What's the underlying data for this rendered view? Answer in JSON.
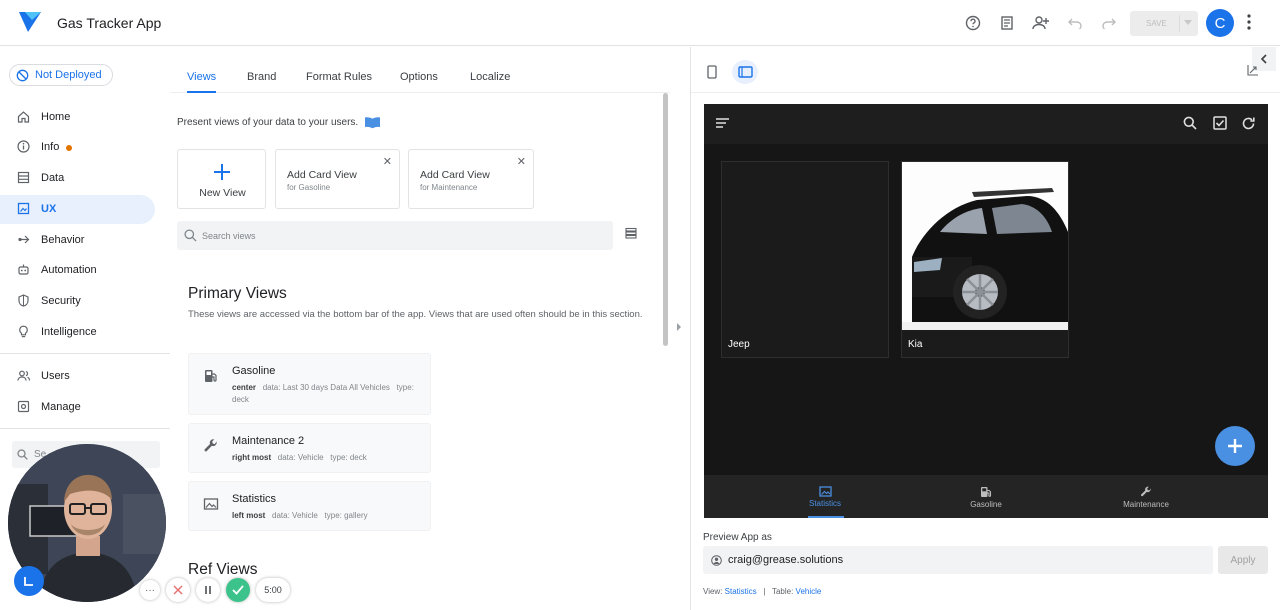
{
  "app": {
    "title": "Gas Tracker App"
  },
  "toolbar": {
    "save_label": "SAVE",
    "avatar_letter": "C"
  },
  "deploy": {
    "label": "Not Deployed"
  },
  "sidebar": {
    "items": [
      {
        "label": "Home"
      },
      {
        "label": "Info"
      },
      {
        "label": "Data"
      },
      {
        "label": "UX"
      },
      {
        "label": "Behavior"
      },
      {
        "label": "Automation"
      },
      {
        "label": "Security"
      },
      {
        "label": "Intelligence"
      },
      {
        "label": "Users"
      },
      {
        "label": "Manage"
      }
    ],
    "search_placeholder": "Se"
  },
  "tabs": [
    {
      "label": "Views"
    },
    {
      "label": "Brand"
    },
    {
      "label": "Format Rules"
    },
    {
      "label": "Options"
    },
    {
      "label": "Localize"
    }
  ],
  "views": {
    "intro": "Present views of your data to your users.",
    "new_view": "New View",
    "suggestions": [
      {
        "title": "Add Card View",
        "subtitle": "for Gasoline"
      },
      {
        "title": "Add Card View",
        "subtitle": "for Maintenance"
      }
    ],
    "search_placeholder": "Search views"
  },
  "primary": {
    "title": "Primary Views",
    "description": "These views are accessed via the bottom bar of the app. Views that are used often should be in this section.",
    "items": [
      {
        "name": "Gasoline",
        "position": "center",
        "data_label": "data:",
        "data": "Last 30 days Data All Vehicles",
        "type_label": "type:",
        "type": "deck"
      },
      {
        "name": "Maintenance 2",
        "position": "right most",
        "data_label": "data:",
        "data": "Vehicle",
        "type_label": "type:",
        "type": "deck"
      },
      {
        "name": "Statistics",
        "position": "left most",
        "data_label": "data:",
        "data": "Vehicle",
        "type_label": "type:",
        "type": "gallery"
      }
    ]
  },
  "ref": {
    "title": "Ref Views"
  },
  "preview": {
    "gallery": [
      {
        "label": "Jeep"
      },
      {
        "label": "Kia"
      }
    ],
    "bottom_nav": [
      {
        "label": "Statistics"
      },
      {
        "label": "Gasoline"
      },
      {
        "label": "Maintenance"
      }
    ],
    "preview_as_label": "Preview App as",
    "preview_as_value": "craig@grease.solutions",
    "apply_label": "Apply",
    "footer": {
      "view_label": "View:",
      "view": "Statistics",
      "sep": "|",
      "table_label": "Table:",
      "table": "Vehicle"
    }
  },
  "recorder": {
    "timer": "5:00",
    "more": "···"
  },
  "colors": {
    "accent": "#1a73e8",
    "phone_bg": "#161616",
    "fab": "#4a90e2",
    "rec_done": "#3cc38c"
  }
}
